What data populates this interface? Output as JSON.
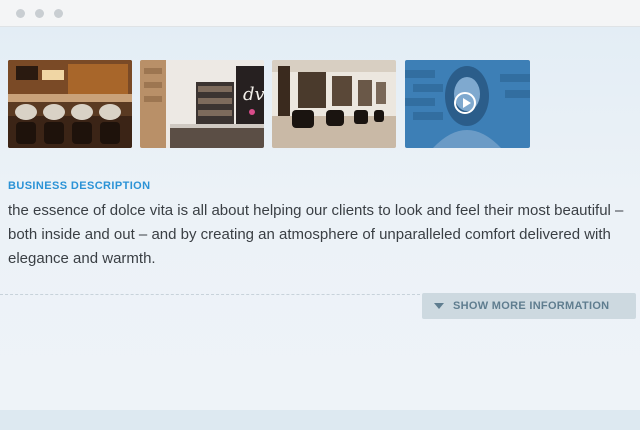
{
  "window": {
    "controls": [
      "close",
      "minimize",
      "maximize"
    ]
  },
  "gallery": {
    "items": [
      {
        "name": "salon-photo-wash-stations",
        "type": "photo"
      },
      {
        "name": "salon-photo-reception-logo",
        "type": "photo"
      },
      {
        "name": "salon-photo-styling-chairs",
        "type": "photo"
      },
      {
        "name": "salon-video",
        "type": "video",
        "icon": "play-icon",
        "overlay_color": "#3d7fb6"
      }
    ]
  },
  "business": {
    "heading": "BUSINESS DESCRIPTION",
    "description": "the essence of dolce vita is all about helping our clients to look and feel their most beautiful – both inside and out – and by creating an atmosphere of unparalleled comfort delivered with elegance and warmth."
  },
  "show_more": {
    "label": "SHOW MORE INFORMATION",
    "icon": "caret-down-icon"
  },
  "colors": {
    "accent": "#2b93d6",
    "button_bg": "#cdd9e0",
    "button_text": "#5f7d8f"
  }
}
